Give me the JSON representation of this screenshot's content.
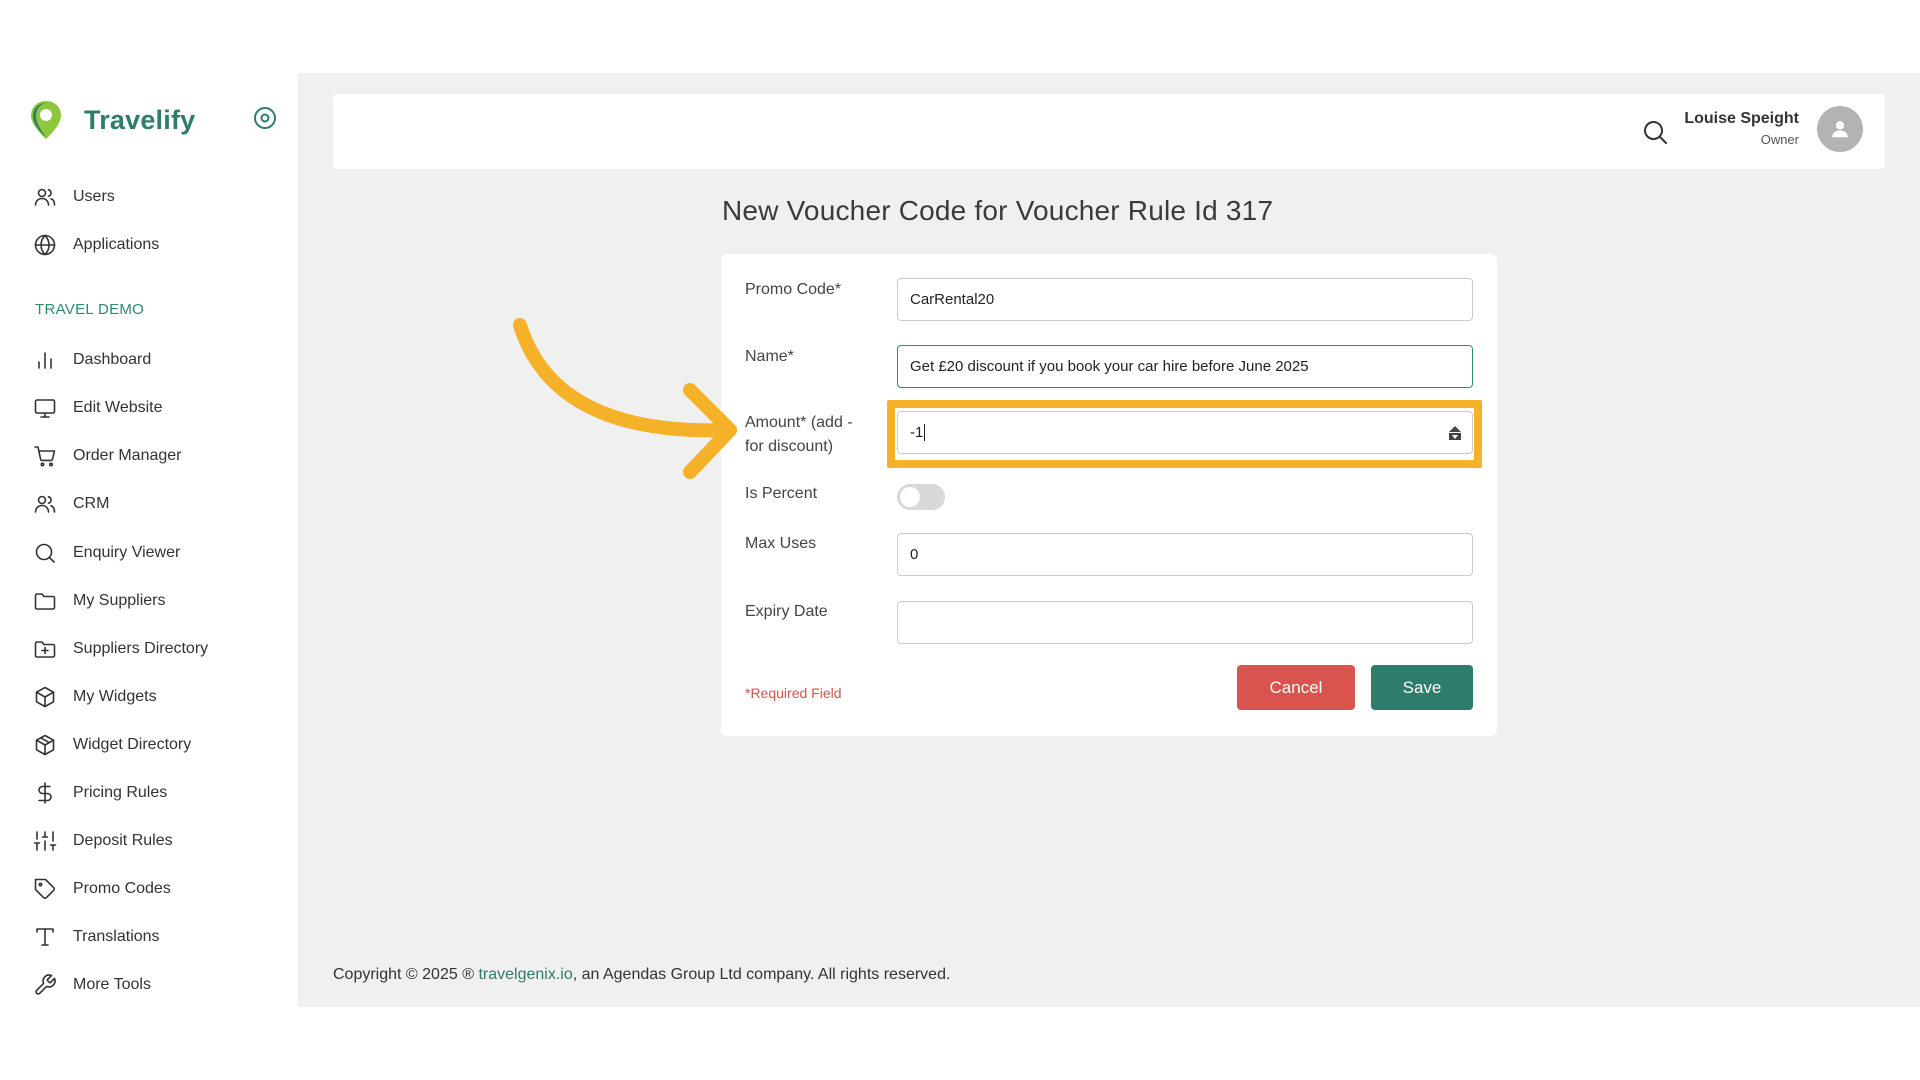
{
  "brand": {
    "name": "Travelify"
  },
  "sidebar": {
    "top_items": [
      {
        "label": "Users",
        "icon": "users-icon"
      },
      {
        "label": "Applications",
        "icon": "globe-icon"
      }
    ],
    "section_title": "TRAVEL DEMO",
    "items": [
      {
        "label": "Dashboard",
        "icon": "bar-chart-icon"
      },
      {
        "label": "Edit Website",
        "icon": "monitor-icon"
      },
      {
        "label": "Order Manager",
        "icon": "cart-icon"
      },
      {
        "label": "CRM",
        "icon": "users-icon"
      },
      {
        "label": "Enquiry Viewer",
        "icon": "search-icon"
      },
      {
        "label": "My Suppliers",
        "icon": "folder-icon"
      },
      {
        "label": "Suppliers Directory",
        "icon": "folder-plus-icon"
      },
      {
        "label": "My Widgets",
        "icon": "box-icon"
      },
      {
        "label": "Widget Directory",
        "icon": "boxes-icon"
      },
      {
        "label": "Pricing Rules",
        "icon": "dollar-icon"
      },
      {
        "label": "Deposit Rules",
        "icon": "sliders-icon"
      },
      {
        "label": "Promo Codes",
        "icon": "tag-icon"
      },
      {
        "label": "Translations",
        "icon": "type-icon"
      },
      {
        "label": "More Tools",
        "icon": "wrench-icon"
      }
    ]
  },
  "header": {
    "user_name": "Louise Speight",
    "user_role": "Owner"
  },
  "page": {
    "title": "New Voucher Code for Voucher Rule Id 317"
  },
  "form": {
    "promo_code": {
      "label": "Promo Code*",
      "value": "CarRental20"
    },
    "name": {
      "label": "Name*",
      "value": "Get £20 discount if you book your car hire before June 2025"
    },
    "amount": {
      "label": "Amount* (add - for discount)",
      "value": "-1"
    },
    "is_percent": {
      "label": "Is Percent",
      "checked": false
    },
    "max_uses": {
      "label": "Max Uses",
      "value": "0"
    },
    "expiry_date": {
      "label": "Expiry Date",
      "value": ""
    },
    "required_note": "*Required Field",
    "cancel_label": "Cancel",
    "save_label": "Save"
  },
  "footer": {
    "prefix": "Copyright © 2025 ® ",
    "link": "travelgenix.io",
    "suffix": ", an Agendas Group Ltd company. All rights reserved."
  },
  "colors": {
    "brand": "#2e7d6b",
    "cancel": "#d9534f",
    "highlight": "#f5b127",
    "logo_lime": "#8dc63f"
  }
}
